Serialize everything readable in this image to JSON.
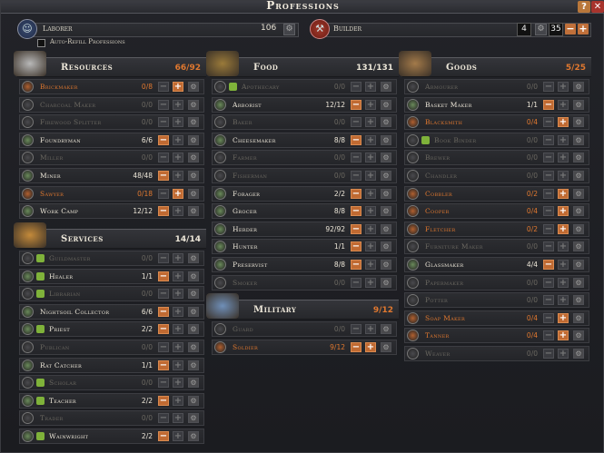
{
  "window": {
    "title": "Professions"
  },
  "top": {
    "laborer": {
      "name": "Laborer",
      "count": "106"
    },
    "builder": {
      "name": "Builder",
      "count": "4",
      "target": "35"
    },
    "auto_refill_label": "Auto-Refill Professions"
  },
  "colors": {
    "warning": "#e0782f",
    "accent": "#c06a32"
  },
  "sections": {
    "resources": {
      "title": "Resources",
      "count": "66/92",
      "rows": [
        {
          "label": "Brickmaker",
          "count": "0/8",
          "state": "warning",
          "bonus": false,
          "minus": false,
          "plus": true,
          "icon": "brick-icon"
        },
        {
          "label": "Charcoal Maker",
          "count": "0/0",
          "state": "disabled",
          "bonus": false,
          "minus": false,
          "plus": false,
          "icon": "charcoal-icon"
        },
        {
          "label": "Firewood Splitter",
          "count": "0/0",
          "state": "disabled",
          "bonus": false,
          "minus": false,
          "plus": false,
          "icon": "firewood-icon"
        },
        {
          "label": "Foundryman",
          "count": "6/6",
          "state": "active",
          "bonus": false,
          "minus": true,
          "plus": false,
          "icon": "foundry-icon"
        },
        {
          "label": "Miller",
          "count": "0/0",
          "state": "disabled",
          "bonus": false,
          "minus": false,
          "plus": false,
          "icon": "mill-icon"
        },
        {
          "label": "Miner",
          "count": "48/48",
          "state": "active",
          "bonus": false,
          "minus": true,
          "plus": false,
          "icon": "pickaxe-icon"
        },
        {
          "label": "Sawyer",
          "count": "0/18",
          "state": "warning",
          "bonus": false,
          "minus": false,
          "plus": true,
          "icon": "saw-icon"
        },
        {
          "label": "Work Camp",
          "count": "12/12",
          "state": "active",
          "bonus": false,
          "minus": true,
          "plus": false,
          "icon": "axe-icon"
        }
      ]
    },
    "services": {
      "title": "Services",
      "count": "14/14",
      "rows": [
        {
          "label": "Guildmaster",
          "count": "0/0",
          "state": "disabled",
          "bonus": true,
          "minus": false,
          "plus": false,
          "icon": "guild-icon"
        },
        {
          "label": "Healer",
          "count": "1/1",
          "state": "active",
          "bonus": true,
          "minus": true,
          "plus": false,
          "icon": "healer-icon"
        },
        {
          "label": "Librarian",
          "count": "0/0",
          "state": "disabled",
          "bonus": true,
          "minus": false,
          "plus": false,
          "icon": "book-icon"
        },
        {
          "label": "Nightsoil Collector",
          "count": "6/6",
          "state": "active",
          "bonus": false,
          "minus": true,
          "plus": false,
          "icon": "bucket-icon"
        },
        {
          "label": "Priest",
          "count": "2/2",
          "state": "active",
          "bonus": true,
          "minus": true,
          "plus": false,
          "icon": "priest-icon"
        },
        {
          "label": "Publican",
          "count": "0/0",
          "state": "disabled",
          "bonus": false,
          "minus": false,
          "plus": false,
          "icon": "tavern-icon"
        },
        {
          "label": "Rat Catcher",
          "count": "1/1",
          "state": "active",
          "bonus": false,
          "minus": true,
          "plus": false,
          "icon": "rat-icon"
        },
        {
          "label": "Scholar",
          "count": "0/0",
          "state": "disabled",
          "bonus": true,
          "minus": false,
          "plus": false,
          "icon": "scholar-icon"
        },
        {
          "label": "Teacher",
          "count": "2/2",
          "state": "active",
          "bonus": true,
          "minus": true,
          "plus": false,
          "icon": "teacher-icon"
        },
        {
          "label": "Trader",
          "count": "0/0",
          "state": "disabled",
          "bonus": false,
          "minus": false,
          "plus": false,
          "icon": "trade-icon"
        },
        {
          "label": "Wainwright",
          "count": "2/2",
          "state": "active",
          "bonus": true,
          "minus": true,
          "plus": false,
          "icon": "wheel-icon"
        }
      ]
    },
    "food": {
      "title": "Food",
      "count": "131/131",
      "rows": [
        {
          "label": "Apothecary",
          "count": "0/0",
          "state": "disabled",
          "bonus": true,
          "minus": false,
          "plus": false,
          "icon": "potion-icon"
        },
        {
          "label": "Arborist",
          "count": "12/12",
          "state": "active",
          "bonus": false,
          "minus": true,
          "plus": false,
          "icon": "apple-icon"
        },
        {
          "label": "Baker",
          "count": "0/0",
          "state": "disabled",
          "bonus": false,
          "minus": false,
          "plus": false,
          "icon": "bread-icon"
        },
        {
          "label": "Cheesemaker",
          "count": "8/8",
          "state": "active",
          "bonus": false,
          "minus": true,
          "plus": false,
          "icon": "cheese-icon"
        },
        {
          "label": "Farmer",
          "count": "0/0",
          "state": "disabled",
          "bonus": false,
          "minus": false,
          "plus": false,
          "icon": "wheat-icon"
        },
        {
          "label": "Fisherman",
          "count": "0/0",
          "state": "disabled",
          "bonus": false,
          "minus": false,
          "plus": false,
          "icon": "fish-icon"
        },
        {
          "label": "Forager",
          "count": "2/2",
          "state": "active",
          "bonus": false,
          "minus": true,
          "plus": false,
          "icon": "leaf-icon"
        },
        {
          "label": "Grocer",
          "count": "8/8",
          "state": "active",
          "bonus": false,
          "minus": true,
          "plus": false,
          "icon": "grocer-icon"
        },
        {
          "label": "Herder",
          "count": "92/92",
          "state": "active",
          "bonus": false,
          "minus": true,
          "plus": false,
          "icon": "sheep-icon"
        },
        {
          "label": "Hunter",
          "count": "1/1",
          "state": "active",
          "bonus": false,
          "minus": true,
          "plus": false,
          "icon": "bow-icon"
        },
        {
          "label": "Preservist",
          "count": "8/8",
          "state": "active",
          "bonus": false,
          "minus": true,
          "plus": false,
          "icon": "jar-icon"
        },
        {
          "label": "Smoker",
          "count": "0/0",
          "state": "disabled",
          "bonus": false,
          "minus": false,
          "plus": false,
          "icon": "smoke-icon"
        }
      ]
    },
    "military": {
      "title": "Military",
      "count": "9/12",
      "rows": [
        {
          "label": "Guard",
          "count": "0/0",
          "state": "disabled",
          "bonus": false,
          "minus": false,
          "plus": false,
          "icon": "shield-icon"
        },
        {
          "label": "Soldier",
          "count": "9/12",
          "state": "warning",
          "bonus": false,
          "minus": true,
          "plus": true,
          "icon": "sword-icon"
        }
      ]
    },
    "goods": {
      "title": "Goods",
      "count": "5/25",
      "rows": [
        {
          "label": "Armourer",
          "count": "0/0",
          "state": "disabled",
          "bonus": false,
          "minus": false,
          "plus": false,
          "icon": "armour-icon"
        },
        {
          "label": "Basket Maker",
          "count": "1/1",
          "state": "active",
          "bonus": false,
          "minus": true,
          "plus": false,
          "icon": "basket-icon"
        },
        {
          "label": "Blacksmith",
          "count": "0/4",
          "state": "warning",
          "bonus": false,
          "minus": false,
          "plus": true,
          "icon": "anvil-icon"
        },
        {
          "label": "Book Binder",
          "count": "0/0",
          "state": "disabled",
          "bonus": true,
          "minus": false,
          "plus": false,
          "icon": "binder-icon"
        },
        {
          "label": "Brewer",
          "count": "0/0",
          "state": "disabled",
          "bonus": false,
          "minus": false,
          "plus": false,
          "icon": "beer-icon"
        },
        {
          "label": "Chandler",
          "count": "0/0",
          "state": "disabled",
          "bonus": false,
          "minus": false,
          "plus": false,
          "icon": "candle-icon"
        },
        {
          "label": "Cobbler",
          "count": "0/2",
          "state": "warning",
          "bonus": false,
          "minus": false,
          "plus": true,
          "icon": "shoe-icon"
        },
        {
          "label": "Cooper",
          "count": "0/4",
          "state": "warning",
          "bonus": false,
          "minus": false,
          "plus": true,
          "icon": "barrel-icon"
        },
        {
          "label": "Fletcher",
          "count": "0/2",
          "state": "warning",
          "bonus": false,
          "minus": false,
          "plus": true,
          "icon": "arrow-icon"
        },
        {
          "label": "Furniture Maker",
          "count": "0/0",
          "state": "disabled",
          "bonus": false,
          "minus": false,
          "plus": false,
          "icon": "chair-icon"
        },
        {
          "label": "Glassmaker",
          "count": "4/4",
          "state": "active",
          "bonus": false,
          "minus": true,
          "plus": false,
          "icon": "glass-icon"
        },
        {
          "label": "Papermaker",
          "count": "0/0",
          "state": "disabled",
          "bonus": false,
          "minus": false,
          "plus": false,
          "icon": "paper-icon"
        },
        {
          "label": "Potter",
          "count": "0/0",
          "state": "disabled",
          "bonus": false,
          "minus": false,
          "plus": false,
          "icon": "pot-icon"
        },
        {
          "label": "Soap Maker",
          "count": "0/4",
          "state": "warning",
          "bonus": false,
          "minus": false,
          "plus": true,
          "icon": "soap-icon"
        },
        {
          "label": "Tanner",
          "count": "0/4",
          "state": "warning",
          "bonus": false,
          "minus": false,
          "plus": true,
          "icon": "hide-icon"
        },
        {
          "label": "Weaver",
          "count": "0/0",
          "state": "disabled",
          "bonus": false,
          "minus": false,
          "plus": false,
          "icon": "loom-icon"
        }
      ]
    }
  }
}
